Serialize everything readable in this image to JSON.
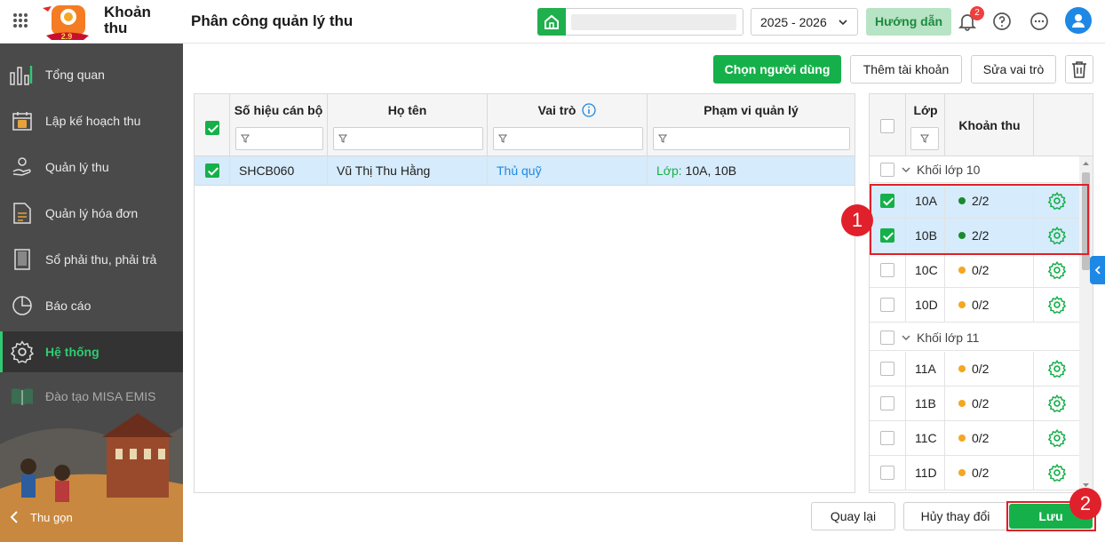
{
  "header": {
    "app_name": "Khoản thu",
    "logo_text": "2.9",
    "page_title": "Phân công quản lý thu",
    "school_placeholder": "",
    "year": "2025 - 2026",
    "help_label": "Hướng dẫn",
    "notification_count": "2"
  },
  "sidebar": {
    "items": [
      {
        "label": "Tổng quan",
        "icon": "chart-bars-icon"
      },
      {
        "label": "Lập kế hoạch thu",
        "icon": "calendar-money-icon"
      },
      {
        "label": "Quản lý thu",
        "icon": "hand-coin-icon"
      },
      {
        "label": "Quản lý hóa đơn",
        "icon": "invoice-icon"
      },
      {
        "label": "Sổ phải thu, phải trả",
        "icon": "ledger-book-icon"
      },
      {
        "label": "Báo cáo",
        "icon": "pie-chart-icon"
      },
      {
        "label": "Hệ thống",
        "icon": "gear-icon",
        "active": true
      },
      {
        "label": "Đào tạo MISA EMIS",
        "icon": "open-book-icon"
      }
    ],
    "collapse_label": "Thu gọn"
  },
  "toolbar": {
    "choose_user": "Chọn người dùng",
    "add_account": "Thêm tài khoản",
    "edit_role": "Sửa vai trò"
  },
  "users_table": {
    "columns": [
      "Số hiệu cán bộ",
      "Họ tên",
      "Vai trò",
      "Phạm vi quản lý"
    ],
    "rows": [
      {
        "code": "SHCB060",
        "name": "Vũ Thị Thu Hằng",
        "role": "Thủ quỹ",
        "scope_prefix": "Lớp:",
        "scope_value": "10A, 10B"
      }
    ]
  },
  "class_table": {
    "columns": [
      "Lớp",
      "Khoản thu"
    ],
    "groups": [
      {
        "label": "Khối lớp 10",
        "rows": [
          {
            "class": "10A",
            "fees": "2/2",
            "status": "done",
            "checked": true
          },
          {
            "class": "10B",
            "fees": "2/2",
            "status": "done",
            "checked": true
          },
          {
            "class": "10C",
            "fees": "0/2",
            "status": "pending",
            "checked": false
          },
          {
            "class": "10D",
            "fees": "0/2",
            "status": "pending",
            "checked": false
          }
        ]
      },
      {
        "label": "Khối lớp 11",
        "rows": [
          {
            "class": "11A",
            "fees": "0/2",
            "status": "pending",
            "checked": false
          },
          {
            "class": "11B",
            "fees": "0/2",
            "status": "pending",
            "checked": false
          },
          {
            "class": "11C",
            "fees": "0/2",
            "status": "pending",
            "checked": false
          },
          {
            "class": "11D",
            "fees": "0/2",
            "status": "pending",
            "checked": false
          }
        ]
      }
    ]
  },
  "footer": {
    "back": "Quay lại",
    "cancel": "Hủy thay đổi",
    "save": "Lưu"
  },
  "callouts": [
    "1",
    "2"
  ],
  "colors": {
    "accent": "#16b04a",
    "selection": "#d6ebfb",
    "highlight": "#e0202a",
    "done": "#1a8a2e",
    "pending": "#f5a623"
  }
}
